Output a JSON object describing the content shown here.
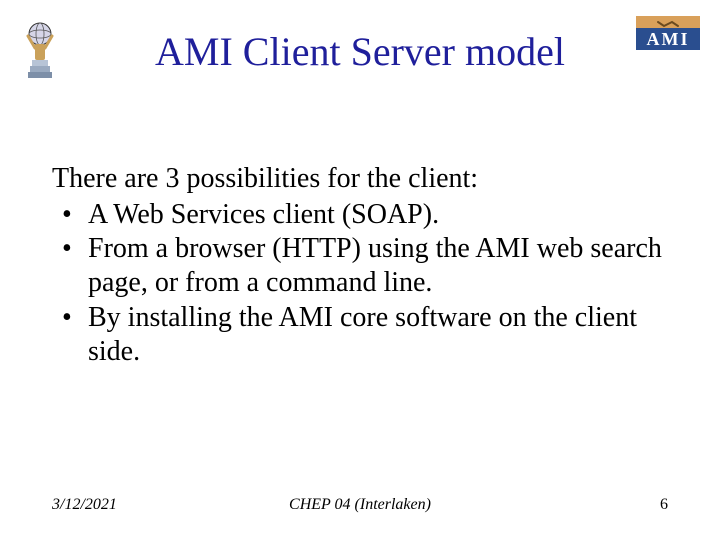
{
  "title": "AMI Client Server model",
  "logo_right_text": "AMI",
  "body": {
    "intro": "There are 3 possibilities for the client:",
    "bullets": [
      "A Web Services client (SOAP).",
      "From a browser (HTTP) using the AMI web search page, or from a command line.",
      "By installing the AMI core software on the client side."
    ]
  },
  "footer": {
    "date": "3/12/2021",
    "venue": "CHEP 04 (Interlaken)",
    "page": "6"
  }
}
